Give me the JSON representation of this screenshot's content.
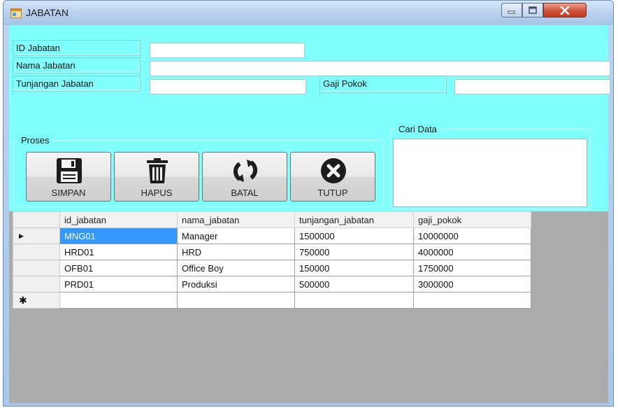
{
  "window": {
    "title": "JABATAN"
  },
  "form": {
    "id_label": "ID Jabatan",
    "id_value": "",
    "nama_label": "Nama Jabatan",
    "nama_value": "",
    "tunjangan_label": "Tunjangan Jabatan",
    "tunjangan_value": "",
    "gaji_label": "Gaji Pokok",
    "gaji_value": ""
  },
  "proses": {
    "legend": "Proses",
    "buttons": [
      {
        "label": "SIMPAN",
        "icon": "save-icon"
      },
      {
        "label": "HAPUS",
        "icon": "trash-icon"
      },
      {
        "label": "BATAL",
        "icon": "refresh-icon"
      },
      {
        "label": "TUTUP",
        "icon": "close-circle-icon"
      }
    ]
  },
  "cari": {
    "legend": "Cari Data"
  },
  "grid": {
    "columns": [
      "id_jabatan",
      "nama_jabatan",
      "tunjangan_jabatan",
      "gaji_pokok"
    ],
    "rows": [
      [
        "MNG01",
        "Manager",
        "1500000",
        "10000000"
      ],
      [
        "HRD01",
        "HRD",
        "750000",
        "4000000"
      ],
      [
        "OFB01",
        "Office Boy",
        "150000",
        "1750000"
      ],
      [
        "PRD01",
        "Produksi",
        "500000",
        "3000000"
      ]
    ],
    "current_marker": "▶",
    "new_row_marker": "✱"
  },
  "colors": {
    "client_bg": "#80ffff",
    "selection": "#3399ff",
    "grid_bg": "#ababab"
  }
}
